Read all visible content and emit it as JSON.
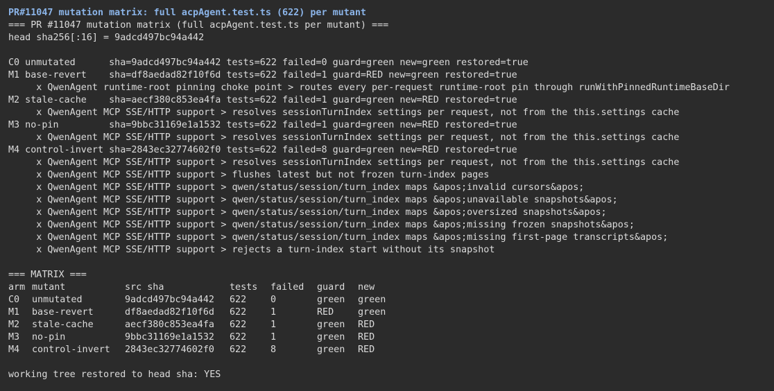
{
  "title": "PR#11047 mutation matrix: full acpAgent.test.ts (622) per mutant",
  "header_line": "=== PR #11047 mutation matrix (full acpAgent.test.ts per mutant) ===",
  "head_line": "head sha256[:16] = 9adcd497bc94a442",
  "runs": [
    {
      "line": "C0 unmutated      sha=9adcd497bc94a442 tests=622 failed=0 guard=green new=green restored=true",
      "failures": []
    },
    {
      "line": "M1 base-revert    sha=df8aedad82f10f6d tests=622 failed=1 guard=RED new=green restored=true",
      "failures": [
        "     x QwenAgent runtime-root pinning choke point > routes every per-request runtime-root pin through runWithPinnedRuntimeBaseDir"
      ]
    },
    {
      "line": "M2 stale-cache    sha=aecf380c853ea4fa tests=622 failed=1 guard=green new=RED restored=true",
      "failures": [
        "     x QwenAgent MCP SSE/HTTP support > resolves sessionTurnIndex settings per request, not from the this.settings cache"
      ]
    },
    {
      "line": "M3 no-pin         sha=9bbc31169e1a1532 tests=622 failed=1 guard=green new=RED restored=true",
      "failures": [
        "     x QwenAgent MCP SSE/HTTP support > resolves sessionTurnIndex settings per request, not from the this.settings cache"
      ]
    },
    {
      "line": "M4 control-invert sha=2843ec32774602f0 tests=622 failed=8 guard=green new=RED restored=true",
      "failures": [
        "     x QwenAgent MCP SSE/HTTP support > resolves sessionTurnIndex settings per request, not from the this.settings cache",
        "     x QwenAgent MCP SSE/HTTP support > flushes latest but not frozen turn-index pages",
        "     x QwenAgent MCP SSE/HTTP support > qwen/status/session/turn_index maps &apos;invalid cursors&apos;",
        "     x QwenAgent MCP SSE/HTTP support > qwen/status/session/turn_index maps &apos;unavailable snapshots&apos;",
        "     x QwenAgent MCP SSE/HTTP support > qwen/status/session/turn_index maps &apos;oversized snapshots&apos;",
        "     x QwenAgent MCP SSE/HTTP support > qwen/status/session/turn_index maps &apos;missing frozen snapshots&apos;",
        "     x QwenAgent MCP SSE/HTTP support > qwen/status/session/turn_index maps &apos;missing first-page transcripts&apos;",
        "     x QwenAgent MCP SSE/HTTP support > rejects a turn-index start without its snapshot"
      ]
    }
  ],
  "matrix": {
    "heading": "=== MATRIX ===",
    "columns": [
      "arm",
      "mutant",
      "src sha",
      "tests",
      "failed",
      "guard",
      "new"
    ],
    "rows": [
      [
        "C0",
        "unmutated",
        "9adcd497bc94a442",
        "622",
        "0",
        "green",
        "green"
      ],
      [
        "M1",
        "base-revert",
        "df8aedad82f10f6d",
        "622",
        "1",
        "RED",
        "green"
      ],
      [
        "M2",
        "stale-cache",
        "aecf380c853ea4fa",
        "622",
        "1",
        "green",
        "RED"
      ],
      [
        "M3",
        "no-pin",
        "9bbc31169e1a1532",
        "622",
        "1",
        "green",
        "RED"
      ],
      [
        "M4",
        "control-invert",
        "2843ec32774602f0",
        "622",
        "8",
        "green",
        "RED"
      ]
    ]
  },
  "footer": "working tree restored to head sha: YES",
  "colors": {
    "background": "#2b2b2b",
    "text": "#dcdcdc",
    "title": "#8bb4e8"
  }
}
